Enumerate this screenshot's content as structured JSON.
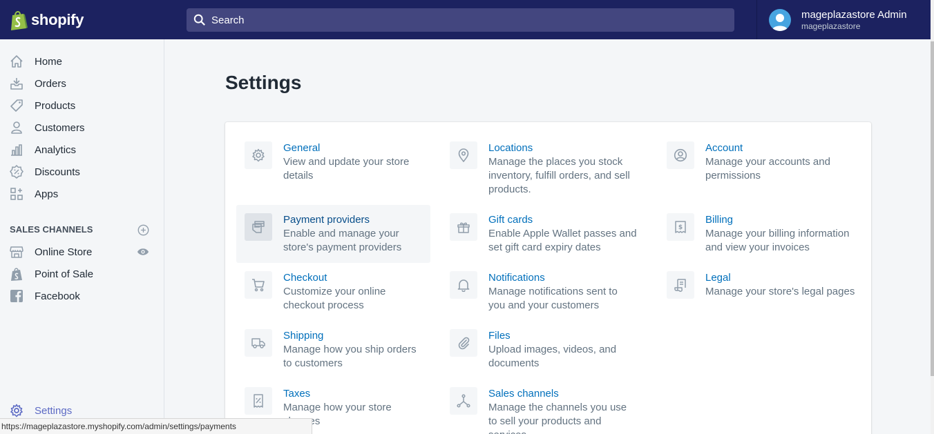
{
  "topbar": {
    "brand": "shopify",
    "search": {
      "placeholder": "Search"
    },
    "user": {
      "name": "mageplazastore Admin",
      "store": "mageplazastore"
    }
  },
  "sidebar": {
    "items": [
      {
        "label": "Home",
        "icon": "home-icon"
      },
      {
        "label": "Orders",
        "icon": "orders-icon"
      },
      {
        "label": "Products",
        "icon": "tag-icon"
      },
      {
        "label": "Customers",
        "icon": "person-icon"
      },
      {
        "label": "Analytics",
        "icon": "bar-chart-icon"
      },
      {
        "label": "Discounts",
        "icon": "discount-icon"
      },
      {
        "label": "Apps",
        "icon": "apps-icon"
      }
    ],
    "sales_channels_heading": "SALES CHANNELS",
    "channels": [
      {
        "label": "Online Store",
        "icon": "store-icon"
      },
      {
        "label": "Point of Sale",
        "icon": "pos-icon"
      },
      {
        "label": "Facebook",
        "icon": "facebook-icon"
      }
    ],
    "settings_label": "Settings"
  },
  "main": {
    "title": "Settings",
    "settings": [
      {
        "title": "General",
        "desc": "View and update your store details",
        "icon": "gear-icon"
      },
      {
        "title": "Locations",
        "desc": "Manage the places you stock inventory, fulfill orders, and sell products.",
        "icon": "location-pin-icon"
      },
      {
        "title": "Account",
        "desc": "Manage your accounts and permissions",
        "icon": "account-icon"
      },
      {
        "title": "Payment providers",
        "desc": "Enable and manage your store's payment providers",
        "icon": "payment-icon"
      },
      {
        "title": "Gift cards",
        "desc": "Enable Apple Wallet passes and set gift card expiry dates",
        "icon": "gift-icon"
      },
      {
        "title": "Billing",
        "desc": "Manage your billing information and view your invoices",
        "icon": "billing-icon"
      },
      {
        "title": "Checkout",
        "desc": "Customize your online checkout process",
        "icon": "cart-icon"
      },
      {
        "title": "Notifications",
        "desc": "Manage notifications sent to you and your customers",
        "icon": "bell-icon"
      },
      {
        "title": "Legal",
        "desc": "Manage your store's legal pages",
        "icon": "legal-icon"
      },
      {
        "title": "Shipping",
        "desc": "Manage how you ship orders to customers",
        "icon": "truck-icon"
      },
      {
        "title": "Files",
        "desc": "Upload images, videos, and documents",
        "icon": "paperclip-icon"
      },
      {
        "title": "Taxes",
        "desc": "Manage how your store charges",
        "icon": "tax-icon"
      },
      {
        "title": "Sales channels",
        "desc": "Manage the channels you use to sell your products and services",
        "icon": "channels-icon"
      }
    ]
  },
  "status_url": "https://mageplazastore.myshopify.com/admin/settings/payments",
  "colors": {
    "topbar": "#1c2260",
    "link": "#006fbb",
    "accent": "#5c6ac4"
  }
}
